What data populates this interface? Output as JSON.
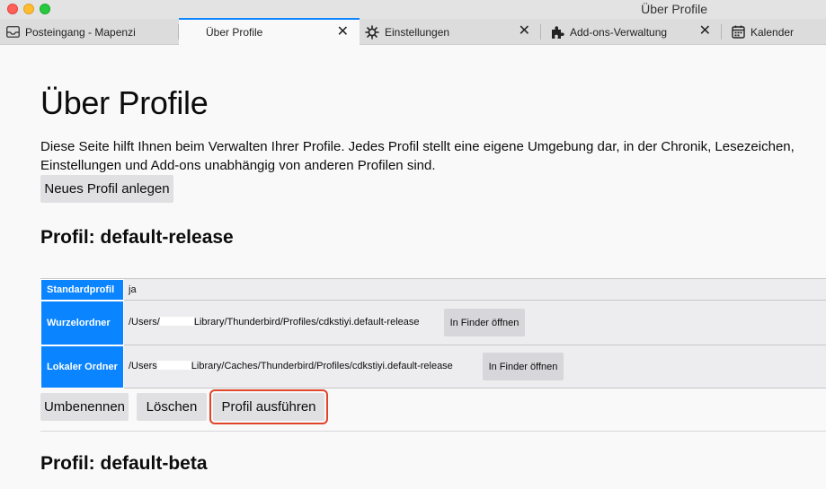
{
  "window": {
    "title": "Über Profile"
  },
  "tabs": [
    {
      "label": "Posteingang - Mapenzi",
      "icon": "inbox-icon"
    },
    {
      "label": "Über Profile",
      "close": "✕"
    },
    {
      "label": "Einstellungen",
      "icon": "gear-icon",
      "close": "✕"
    },
    {
      "label": "Add-ons-Verwaltung",
      "icon": "puzzle-icon",
      "close": "✕"
    },
    {
      "label": "Kalender",
      "icon": "calendar-icon"
    }
  ],
  "page": {
    "title": "Über Profile",
    "intro": "Diese Seite hilft Ihnen beim Verwalten Ihrer Profile. Jedes Profil stellt eine eigene Umgebung dar, in der Chronik, Lesezeichen, Einstellungen und Add-ons unabhängig von anderen Profilen sind.",
    "new_profile_button": "Neues Profil anlegen"
  },
  "profiles": [
    {
      "heading": "Profil: default-release",
      "rows": [
        {
          "label": "Standardprofil",
          "value": "ja"
        },
        {
          "label": "Wurzelordner",
          "value_prefix": "/Users/",
          "value_suffix": "Library/Thunderbird/Profiles/cdkstiyi.default-release",
          "button": "In Finder öffnen"
        },
        {
          "label": "Lokaler Ordner",
          "value_prefix": "/Users",
          "value_suffix": "Library/Caches/Thunderbird/Profiles/cdkstiyi.default-release",
          "button": "In Finder öffnen"
        }
      ],
      "actions": {
        "rename": "Umbenennen",
        "delete": "Löschen",
        "launch": "Profil ausführen"
      }
    },
    {
      "heading": "Profil: default-beta"
    }
  ],
  "colors": {
    "accent": "#0a84ff",
    "highlight": "#e0452a"
  }
}
